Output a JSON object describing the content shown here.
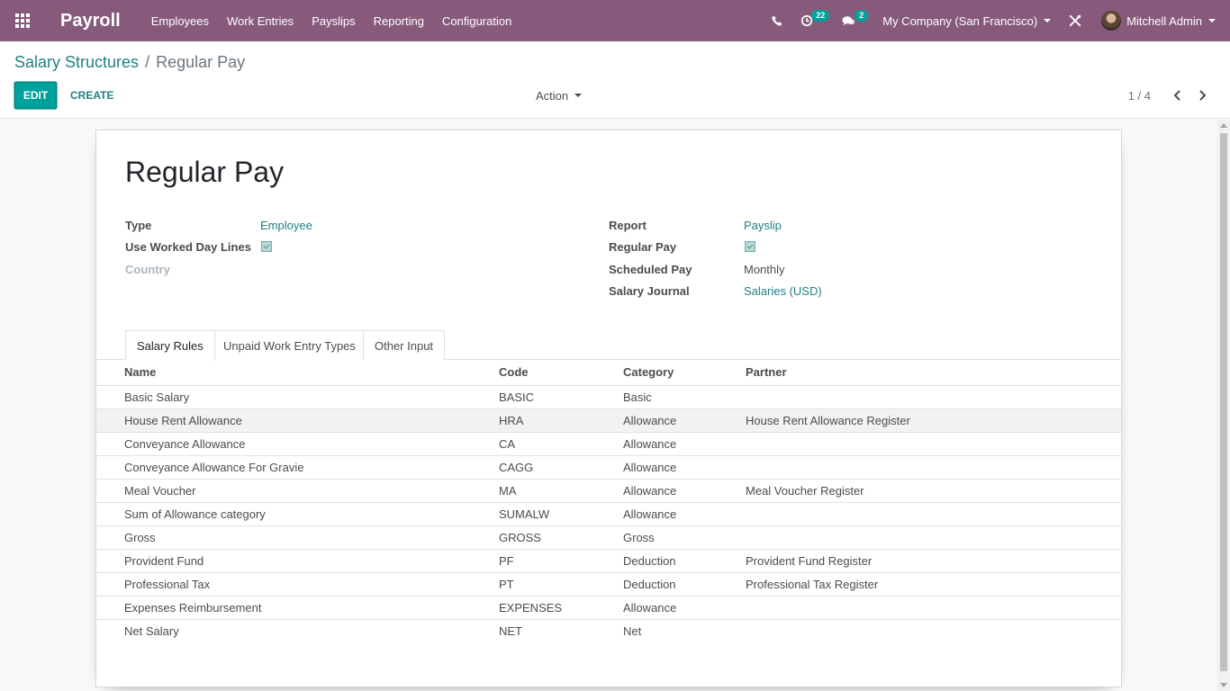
{
  "navbar": {
    "app_title": "Payroll",
    "menu": [
      "Employees",
      "Work Entries",
      "Payslips",
      "Reporting",
      "Configuration"
    ],
    "activity_count": "22",
    "messages_count": "2",
    "company": "My Company (San Francisco)",
    "user": "Mitchell Admin",
    "accent_color": "#875a7b"
  },
  "breadcrumb": {
    "parent": "Salary Structures",
    "separator": "/",
    "current": "Regular Pay"
  },
  "buttons": {
    "edit": "EDIT",
    "create": "CREATE",
    "action": "Action"
  },
  "pager": "1 / 4",
  "record": {
    "title": "Regular Pay",
    "left_fields": [
      {
        "label": "Type",
        "value": "Employee"
      },
      {
        "label": "Use Worked Day Lines",
        "value": "checked"
      },
      {
        "label": "Country",
        "value": ""
      }
    ],
    "right_fields": [
      {
        "label": "Report",
        "value": "Payslip"
      },
      {
        "label": "Regular Pay",
        "value": "checked"
      },
      {
        "label": "Scheduled Pay",
        "value": "Monthly"
      },
      {
        "label": "Salary Journal",
        "value": "Salaries (USD)"
      }
    ]
  },
  "tabs": [
    "Salary Rules",
    "Unpaid Work Entry Types",
    "Other Input"
  ],
  "rules_table": {
    "columns": [
      "Name",
      "Code",
      "Category",
      "Partner"
    ],
    "rows": [
      [
        "Basic Salary",
        "BASIC",
        "Basic",
        ""
      ],
      [
        "House Rent Allowance",
        "HRA",
        "Allowance",
        "House Rent Allowance Register"
      ],
      [
        "Conveyance Allowance",
        "CA",
        "Allowance",
        ""
      ],
      [
        "Conveyance Allowance For Gravie",
        "CAGG",
        "Allowance",
        ""
      ],
      [
        "Meal Voucher",
        "MA",
        "Allowance",
        "Meal Voucher Register"
      ],
      [
        "Sum of Allowance category",
        "SUMALW",
        "Allowance",
        ""
      ],
      [
        "Gross",
        "GROSS",
        "Gross",
        ""
      ],
      [
        "Provident Fund",
        "PF",
        "Deduction",
        "Provident Fund Register"
      ],
      [
        "Professional Tax",
        "PT",
        "Deduction",
        "Professional Tax Register"
      ],
      [
        "Expenses Reimbursement",
        "EXPENSES",
        "Allowance",
        ""
      ],
      [
        "Net Salary",
        "NET",
        "Net",
        ""
      ]
    ]
  }
}
